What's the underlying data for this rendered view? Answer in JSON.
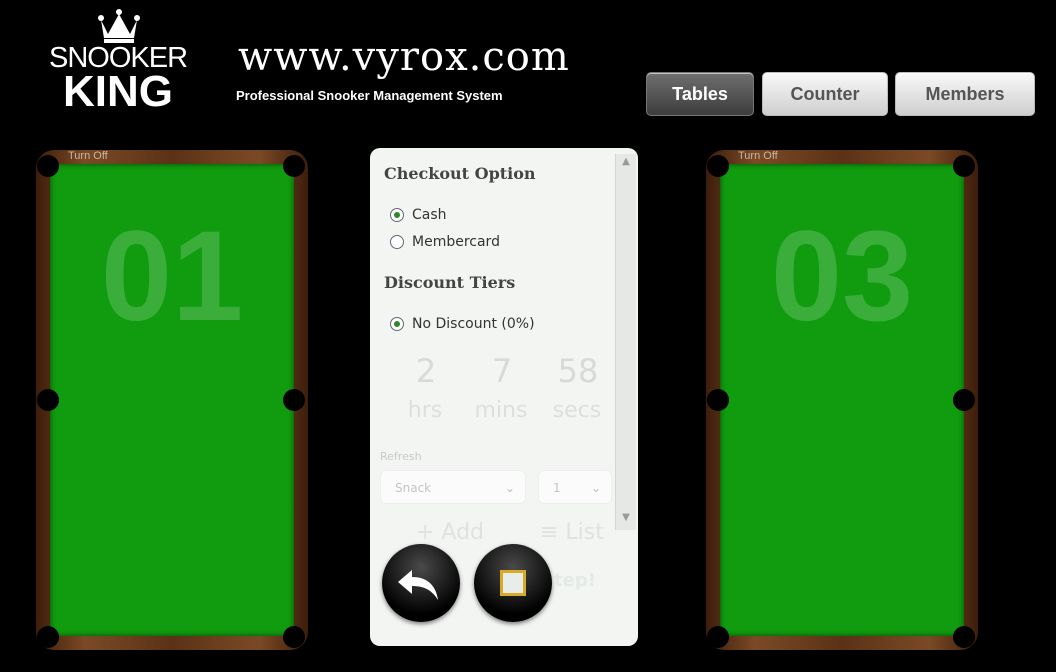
{
  "header": {
    "logo": {
      "top": "SNOOKER",
      "bottom": "KING",
      "icon": "crown-icon"
    },
    "url": "www.vyrox.com",
    "tagline": "Professional Snooker Management System"
  },
  "nav": {
    "items": [
      {
        "label": "Tables",
        "active": true
      },
      {
        "label": "Counter",
        "active": false
      },
      {
        "label": "Members",
        "active": false
      }
    ]
  },
  "tables": [
    {
      "number": "01",
      "turn_off_label": "Turn Off"
    },
    {
      "number": "03",
      "turn_off_label": "Turn Off"
    }
  ],
  "panel": {
    "checkout_title": "Checkout Option",
    "checkout_options": [
      {
        "label": "Cash",
        "checked": true
      },
      {
        "label": "Membercard",
        "checked": false
      }
    ],
    "discount_title": "Discount Tiers",
    "discount_options": [
      {
        "label": "No Discount (0%)",
        "checked": true
      }
    ],
    "timer": {
      "hrs_value": "2",
      "hrs_label": "hrs",
      "mins_value": "7",
      "mins_label": "mins",
      "secs_value": "58",
      "secs_label": "secs"
    },
    "faint": {
      "label": "Refresh",
      "select_1": "Snack",
      "select_2": "1",
      "add": "+ Add",
      "list": "≡ List",
      "step": "tep!"
    },
    "buttons": {
      "back_icon": "undo-arrow-icon",
      "stop_icon": "stop-icon"
    }
  },
  "colors": {
    "felt": "#119c0f",
    "wood": "#5a3216",
    "background": "#000000",
    "panel": "#f3f5f3",
    "stop_border": "#d9a92a"
  }
}
